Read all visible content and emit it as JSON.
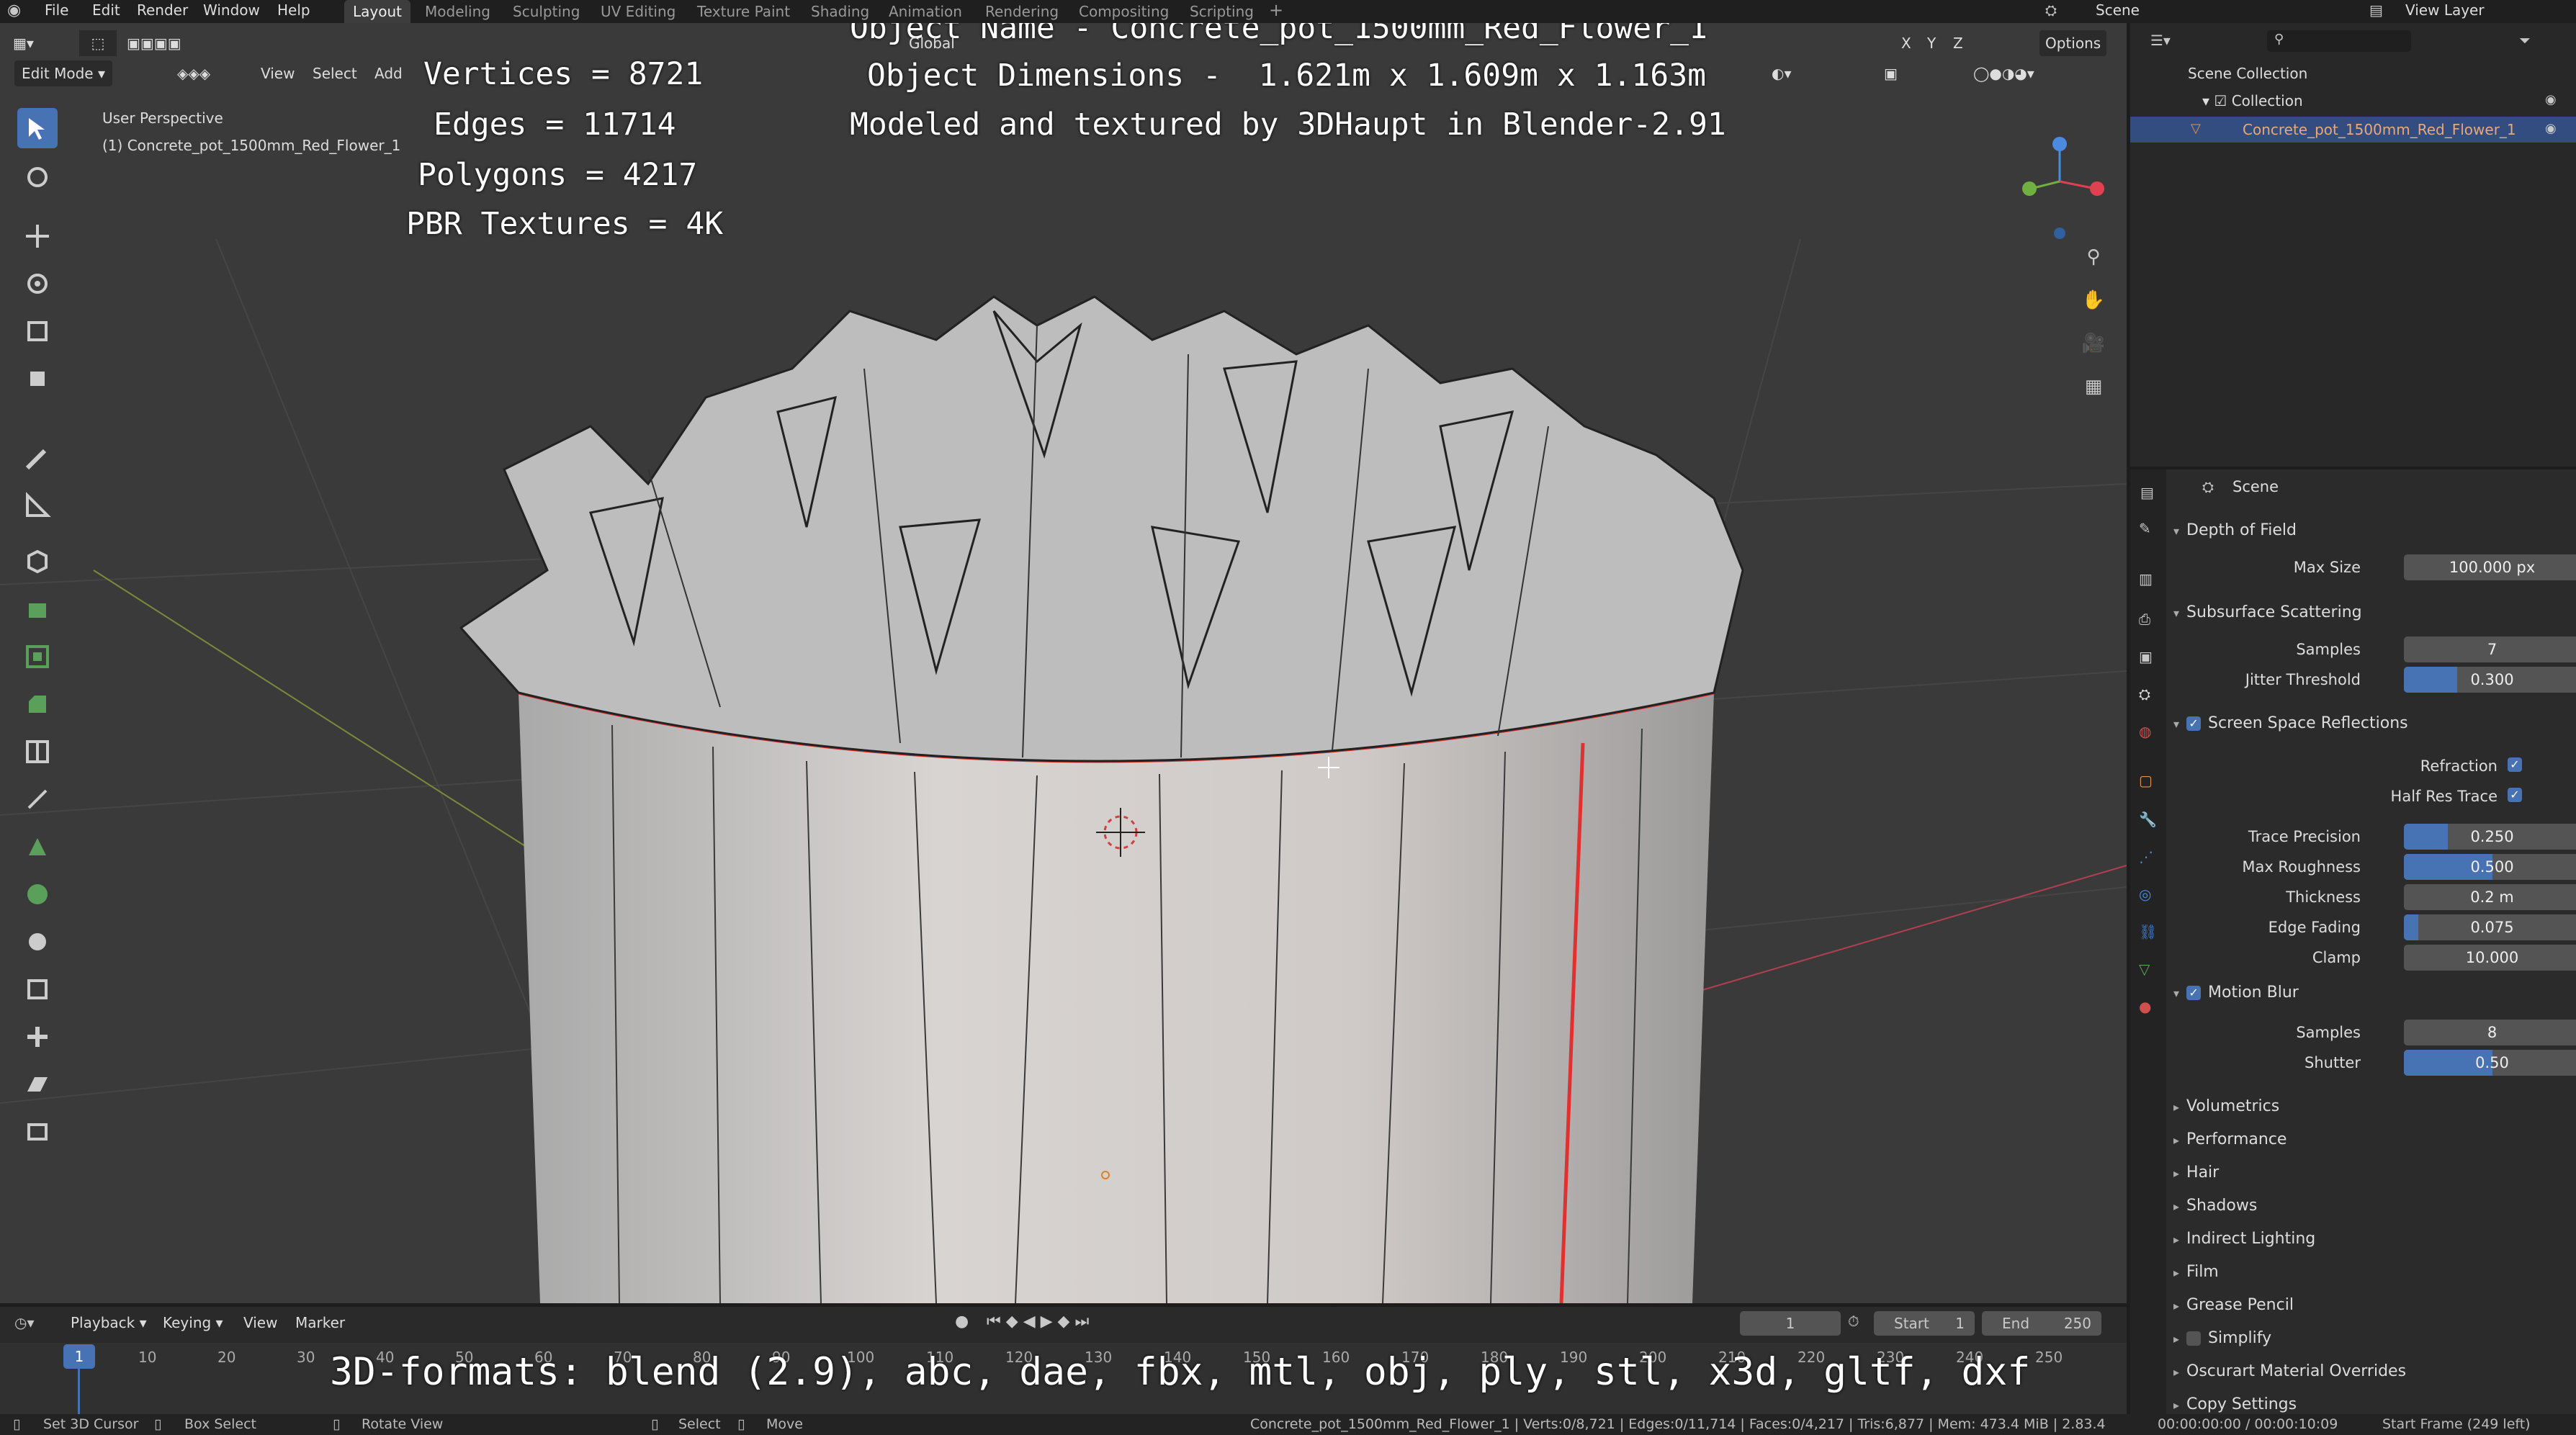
{
  "topbar": {
    "menus": [
      "File",
      "Edit",
      "Render",
      "Window",
      "Help"
    ],
    "workspaces": [
      "Layout",
      "Modeling",
      "Sculpting",
      "UV Editing",
      "Texture Paint",
      "Shading",
      "Animation",
      "Rendering",
      "Compositing",
      "Scripting"
    ],
    "scene": "Scene",
    "view_layer": "View Layer"
  },
  "viewport_header": {
    "mode": "Edit Mode",
    "view": "View",
    "select": "Select",
    "add": "Add",
    "orientation": "Global",
    "options": "Options",
    "axes": [
      "X",
      "Y",
      "Z"
    ]
  },
  "viewport": {
    "perspective": "User Perspective",
    "object_label": "(1) Concrete_pot_1500mm_Red_Flower_1"
  },
  "overlay": {
    "vertices": "Vertices = 8721",
    "edges": "Edges = 11714",
    "polygons": "Polygons = 4217",
    "textures": "PBR Textures = 4K",
    "object_name": "Object Name - Concrete_pot_1500mm_Red_Flower_1",
    "dimensions": "Object Dimensions -  1.621m x 1.609m x 1.163m",
    "credit": "Modeled and textured by 3DHaupt in Blender-2.91",
    "formats": "3D-formats: blend (2.9), abc, dae, fbx, mtl, obj, ply, stl, x3d, gltf, dxf"
  },
  "outliner": {
    "scene_collection": "Scene Collection",
    "collection": "Collection",
    "object": "Concrete_pot_1500mm_Red_Flower_1"
  },
  "properties": {
    "scene_label": "Scene",
    "depth_of_field": "Depth of Field",
    "max_size_label": "Max Size",
    "max_size": "100.000 px",
    "sss": "Subsurface Scattering",
    "samples_label": "Samples",
    "sss_samples": "7",
    "jitter_label": "Jitter Threshold",
    "jitter": "0.300",
    "ssr": "Screen Space Reflections",
    "refraction_label": "Refraction",
    "half_res_label": "Half Res Trace",
    "trace_precision_label": "Trace Precision",
    "trace_precision": "0.250",
    "max_roughness_label": "Max Roughness",
    "max_roughness": "0.500",
    "thickness_label": "Thickness",
    "thickness": "0.2 m",
    "edge_fading_label": "Edge Fading",
    "edge_fading": "0.075",
    "clamp_label": "Clamp",
    "clamp": "10.000",
    "motion_blur": "Motion Blur",
    "mb_samples": "8",
    "shutter_label": "Shutter",
    "shutter": "0.50",
    "collapsed": [
      "Volumetrics",
      "Performance",
      "Hair",
      "Shadows",
      "Indirect Lighting",
      "Film",
      "Grease Pencil",
      "Simplify",
      "Oscurart Material Overrides",
      "Copy Settings"
    ]
  },
  "timeline": {
    "playback": "Playback",
    "keying": "Keying",
    "view": "View",
    "marker": "Marker",
    "current_frame": "1",
    "start_label": "Start",
    "start": "1",
    "end_label": "End",
    "end": "250",
    "ticks": [
      "1",
      "10",
      "20",
      "30",
      "40",
      "50",
      "60",
      "70",
      "80",
      "90",
      "100",
      "110",
      "120",
      "130",
      "140",
      "150",
      "160",
      "170",
      "180",
      "190",
      "200",
      "210",
      "220",
      "230",
      "240",
      "250"
    ]
  },
  "status": {
    "set_cursor": "Set 3D Cursor",
    "box_select": "Box Select",
    "rotate_view": "Rotate View",
    "select": "Select",
    "move": "Move",
    "stats": "Concrete_pot_1500mm_Red_Flower_1 | Verts:0/8,721 | Edges:0/11,714 | Faces:0/4,217 | Tris:6,877 | Mem: 473.4 MiB | 2.83.4",
    "time": "00:00:00:00 / 00:00:10:09",
    "start_frame": "Start Frame (249 left)"
  },
  "colors": {
    "accent": "#4772b3",
    "seam": "#e03030",
    "viewport_bg": "#3a3a3a"
  }
}
